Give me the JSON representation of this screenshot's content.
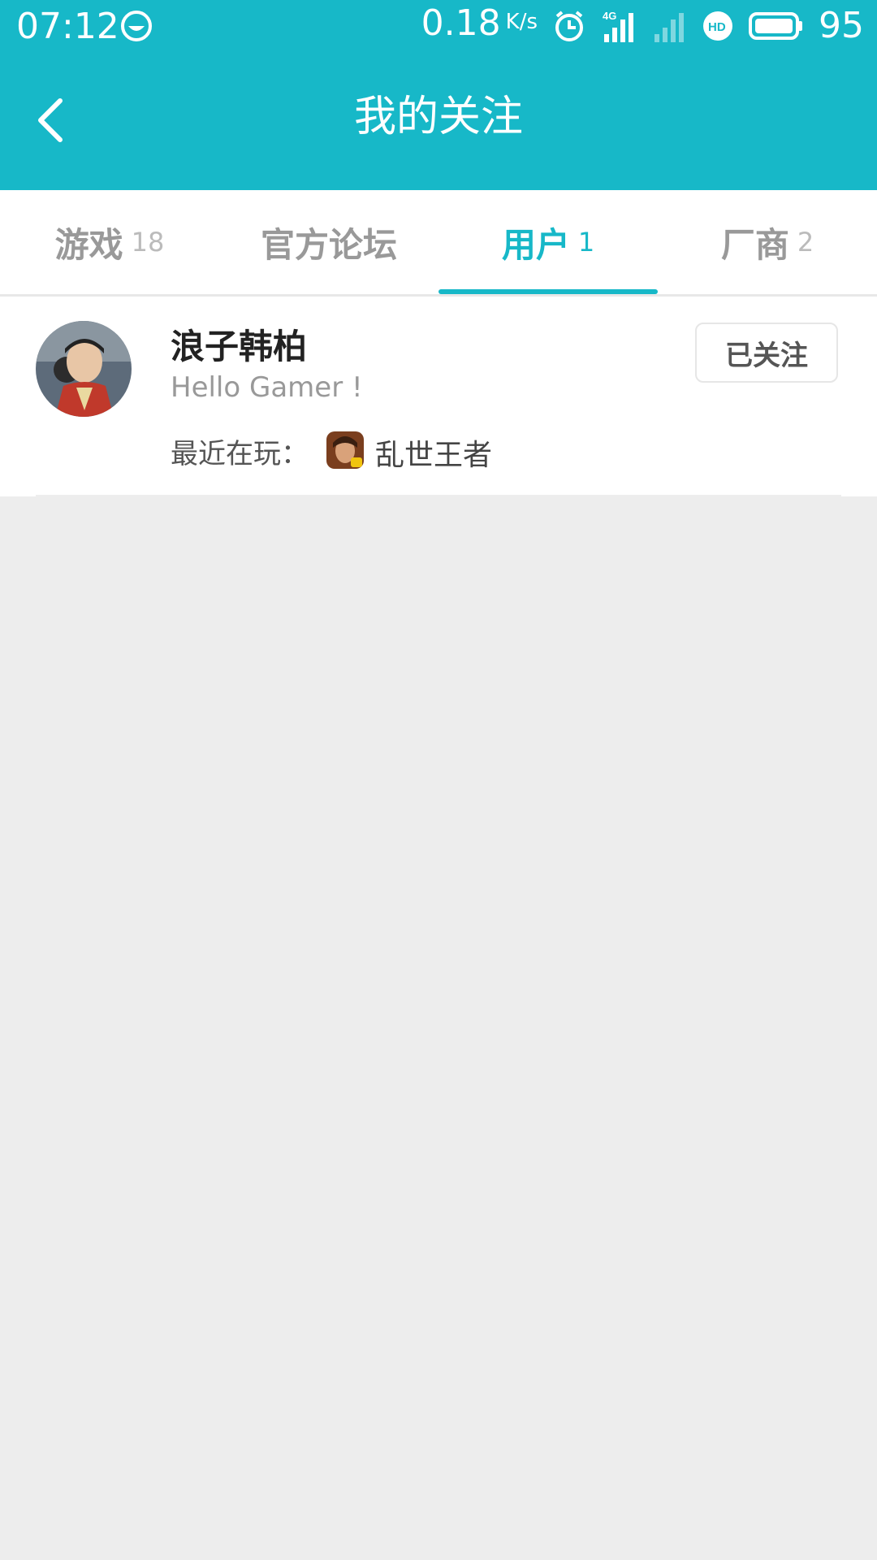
{
  "status_bar": {
    "time": "07:12",
    "net_speed": "0.18",
    "net_speed_unit": "K/s",
    "battery": "95",
    "icons": [
      "smiley-icon",
      "alarm-icon",
      "signal-4g-icon",
      "signal-weak-icon",
      "hd-icon",
      "battery-icon"
    ]
  },
  "header": {
    "title": "我的关注",
    "back_icon": "chevron-left-icon"
  },
  "tabs": [
    {
      "label": "游戏",
      "count": "18",
      "active": false
    },
    {
      "label": "官方论坛",
      "count": "",
      "active": false
    },
    {
      "label": "用户",
      "count": "1",
      "active": true
    },
    {
      "label": "厂商",
      "count": "2",
      "active": false
    }
  ],
  "users": [
    {
      "name": "浪子韩柏",
      "signature": "Hello Gamer !",
      "recent_label": "最近在玩：",
      "recent_game": "乱世王者",
      "follow_label": "已关注"
    }
  ],
  "colors": {
    "accent": "#17b8c8",
    "background": "#ededed"
  }
}
